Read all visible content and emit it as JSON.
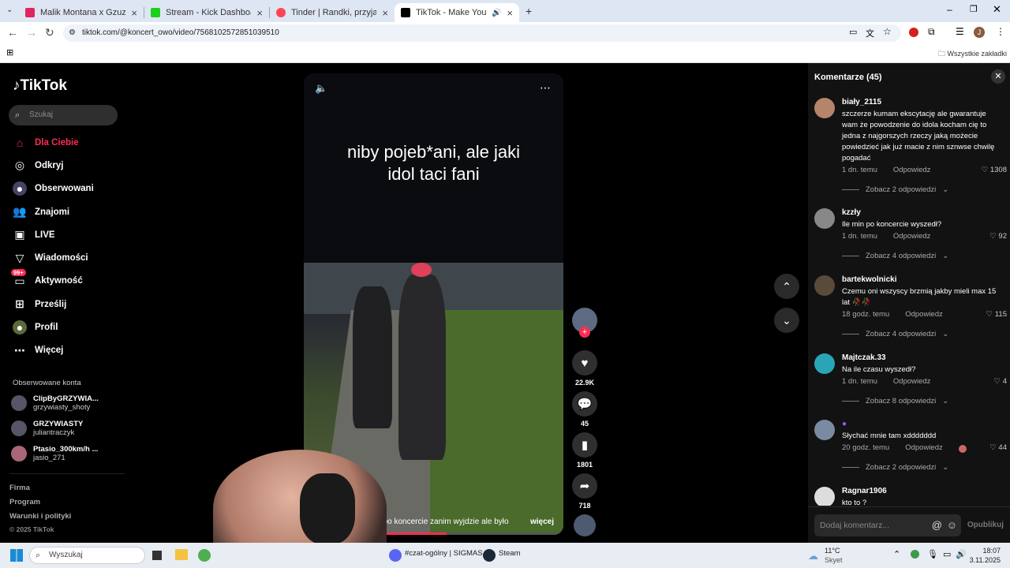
{
  "browser": {
    "tabs": [
      {
        "title": "Malik Montana x Gzuz - Genera",
        "color": "#e0245e"
      },
      {
        "title": "Stream - Kick Dashboard",
        "color": "#1bd11b"
      },
      {
        "title": "Tinder | Randki, przyjaźń, nowe",
        "color": "#ff4458"
      },
      {
        "title": "TikTok - Make Your Day",
        "color": "#000000"
      }
    ],
    "new_tab": "+",
    "url": "tiktok.com/@koncert_owo/video/7568102572851039510",
    "bookmarks_label": "Wszystkie zakładki",
    "profile_initial": "J"
  },
  "tiktok": {
    "logo": "TikTok",
    "search_placeholder": "Szukaj",
    "menu": [
      {
        "label": "Dla Ciebie",
        "icon": "home-icon",
        "active": true
      },
      {
        "label": "Odkryj",
        "icon": "compass-icon"
      },
      {
        "label": "Obserwowani",
        "icon": "following-icon"
      },
      {
        "label": "Znajomi",
        "icon": "friends-icon"
      },
      {
        "label": "LIVE",
        "icon": "live-icon"
      },
      {
        "label": "Wiadomości",
        "icon": "messages-icon"
      },
      {
        "label": "Aktywność",
        "icon": "activity-icon",
        "badge": "99+"
      },
      {
        "label": "Prześlij",
        "icon": "upload-icon"
      },
      {
        "label": "Profil",
        "icon": "profile-icon"
      },
      {
        "label": "Więcej",
        "icon": "more-icon"
      }
    ],
    "followed_header": "Obserwowane konta",
    "followed": [
      {
        "name": "ClipByGRZYWIA...",
        "handle": "grzywiasty_shoty"
      },
      {
        "name": "GRZYWIASTY",
        "handle": "juliantraczyk"
      },
      {
        "name": "Ptasio_300km/h ...",
        "handle": "jasio_271"
      }
    ],
    "footer": [
      "Firma",
      "Program",
      "Warunki i polityki",
      "© 2025 TikTok"
    ]
  },
  "video": {
    "overlay_text": "niby pojeb*ani, ale jaki idol taci fani",
    "caption": "am 3h po koncercie zanim wyjdzie ale było",
    "more": "więcej",
    "progress": 0.55,
    "likes": "22.9K",
    "comments": "45",
    "saves": "1801",
    "shares": "718"
  },
  "comments": {
    "header": "Komentarze (45)",
    "items": [
      {
        "user": "biały_2115",
        "text": "szczerze kumam ekscytację ale gwarantuje wam że powodzenie do idola kocham cię to jedna z najgorszych rzeczy jaką możecie powiedzieć jak już macie z nim sznwse chwilę pogadać",
        "time": "1 dn. temu",
        "reply": "Odpowiedz",
        "likes": "1308",
        "more": "Zobacz 2 odpowiedzi"
      },
      {
        "user": "kzzły",
        "text": "Ile min po koncercie wyszedł?",
        "time": "1 dn. temu",
        "reply": "Odpowiedz",
        "likes": "92",
        "more": "Zobacz 4 odpowiedzi"
      },
      {
        "user": "bartekwolnicki",
        "text": "Czemu oni wszyscy brzmią jakby mieli max 15 lat 🥀🥀",
        "time": "18 godz. temu",
        "reply": "Odpowiedz",
        "likes": "115",
        "more": "Zobacz 4 odpowiedzi"
      },
      {
        "user": "Majtczak.33",
        "text": "Na ile czasu wyszedł?",
        "time": "1 dn. temu",
        "reply": "Odpowiedz",
        "likes": "4",
        "more": "Zobacz 8 odpowiedzi"
      },
      {
        "user": "",
        "text": "Słychać mnie tam xddddddd",
        "time": "20 godz. temu",
        "reply": "Odpowiedz",
        "likes": "44",
        "more": "Zobacz 2 odpowiedzi"
      },
      {
        "user": "Ragnar1906",
        "text": "kto to ?",
        "time": "",
        "reply": "",
        "likes": "",
        "more": ""
      }
    ],
    "input_placeholder": "Dodaj komentarz...",
    "post": "Opublikuj"
  },
  "taskbar": {
    "search": "Wyszukaj",
    "items": [
      "#czat-ogólny | SIGMAS",
      "Steam"
    ],
    "weather_temp": "11°C",
    "weather_desc": "Skyet",
    "time": "18:07",
    "date": "3.11.2025"
  }
}
